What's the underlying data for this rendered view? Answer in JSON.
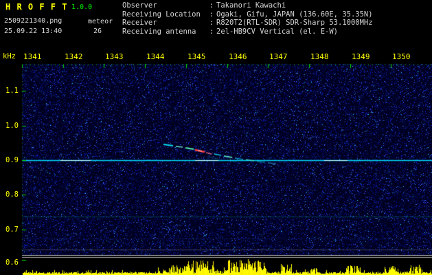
{
  "header": {
    "app_title": "H R O F F T",
    "version": "1.0.0",
    "filename": "2509221340.png",
    "mode": "meteor",
    "datetime": "25.09.22 13:40",
    "count": "26",
    "separator": ":",
    "info": [
      {
        "label": "Observer",
        "value": "Takanori Kawachi"
      },
      {
        "label": "Receiving Location",
        "value": "Ogaki, Gifu, JAPAN (136.60E, 35.35N)"
      },
      {
        "label": "Receiver",
        "value": "R820T2(RTL-SDR) SDR-Sharp 53.1000MHz"
      },
      {
        "label": "Receiving antenna",
        "value": "2el-HB9CV Vertical (el. E-W)"
      }
    ]
  },
  "axes": {
    "freq_unit": "kHz",
    "freq_labels": [
      "1.1",
      "1.0",
      "0.9",
      "0.8",
      "0.7",
      "0.6"
    ],
    "time_labels": [
      "1341",
      "1342",
      "1343",
      "1344",
      "1345",
      "1346",
      "1347",
      "1348",
      "1349",
      "1350"
    ]
  },
  "spectrogram": {
    "carrier_frequency_khz": 0.9,
    "meteor_echo": {
      "time_span_min": "1344.5-1346.8",
      "freq_span_khz": "0.95-0.88"
    },
    "faint_line_khz": 0.74,
    "level_graph": "yellow signal-level bars along bottom edge"
  },
  "colors": {
    "background": "#000000",
    "plot_background": "#000020",
    "noise_blue": "#2040ff",
    "carrier_cyan": "#00e0ff",
    "trace_red": "#ff4040",
    "level_yellow": "#ffff00",
    "tick_green": "#00dd00",
    "axis_label_yellow": "#ffff00",
    "version_green": "#00ee00",
    "text_white": "#d6d6d6",
    "separator_gray": "#d0d0d0"
  }
}
